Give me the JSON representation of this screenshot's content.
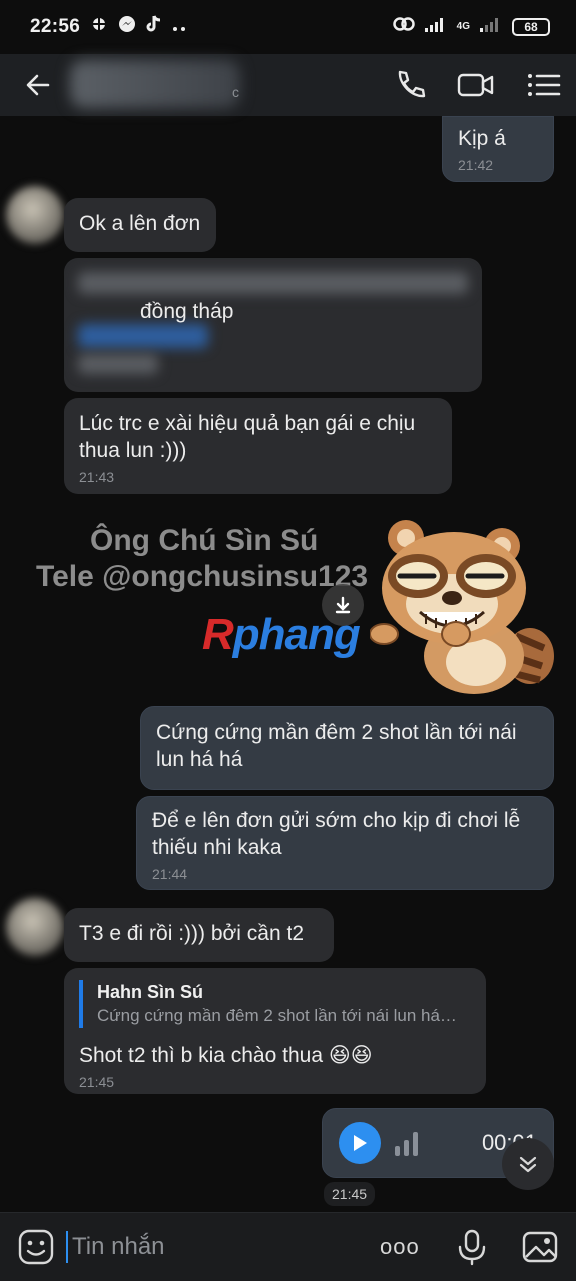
{
  "status_bar": {
    "time": "22:56",
    "network": "4G",
    "battery": "68"
  },
  "header": {
    "contact_suffix": "c"
  },
  "messages": [
    {
      "id": "m1",
      "direction": "out",
      "text": "Kịp á",
      "time": "21:42"
    },
    {
      "id": "m2",
      "direction": "in",
      "text": "Ok a lên đơn"
    },
    {
      "id": "m3",
      "direction": "in",
      "text": "đồng tháp"
    },
    {
      "id": "m4",
      "direction": "in",
      "text": "Lúc trc e xài hiệu quả bạn gái e chịu thua lun :)))",
      "time": "21:43"
    },
    {
      "id": "m5",
      "direction": "out",
      "text": "Cứng cứng mần đêm 2 shot lần tới nái lun há há"
    },
    {
      "id": "m6",
      "direction": "out",
      "text": "Để e lên đơn gửi sớm cho kịp đi chơi lễ thiếu nhi kaka",
      "time": "21:44"
    },
    {
      "id": "m7",
      "direction": "in",
      "text": "T3 e đi rồi :))) bởi cần t2"
    },
    {
      "id": "m8",
      "direction": "in",
      "reply_to_name": "Hahn Sìn Sú",
      "reply_to_text": "Cứng cứng mần đêm 2 shot lần tới nái lun há…",
      "text": "Shot t2 thì b kia chào thua 😆😆",
      "time": "21:45"
    }
  ],
  "voice_message": {
    "duration": "00:01",
    "time": "21:45"
  },
  "watermark": {
    "name": "Ông Chú Sìn Sú",
    "tele": "Tele @ongchusinsu123",
    "brand_r": "R",
    "brand_rest": "phang"
  },
  "composer": {
    "placeholder": "Tin nhắn",
    "more_label": "ooo"
  },
  "colors": {
    "accent": "#2d8ff0",
    "bubble_in": "#2b2c2f",
    "bubble_out": "#343b44",
    "background": "#0d0d0d"
  }
}
